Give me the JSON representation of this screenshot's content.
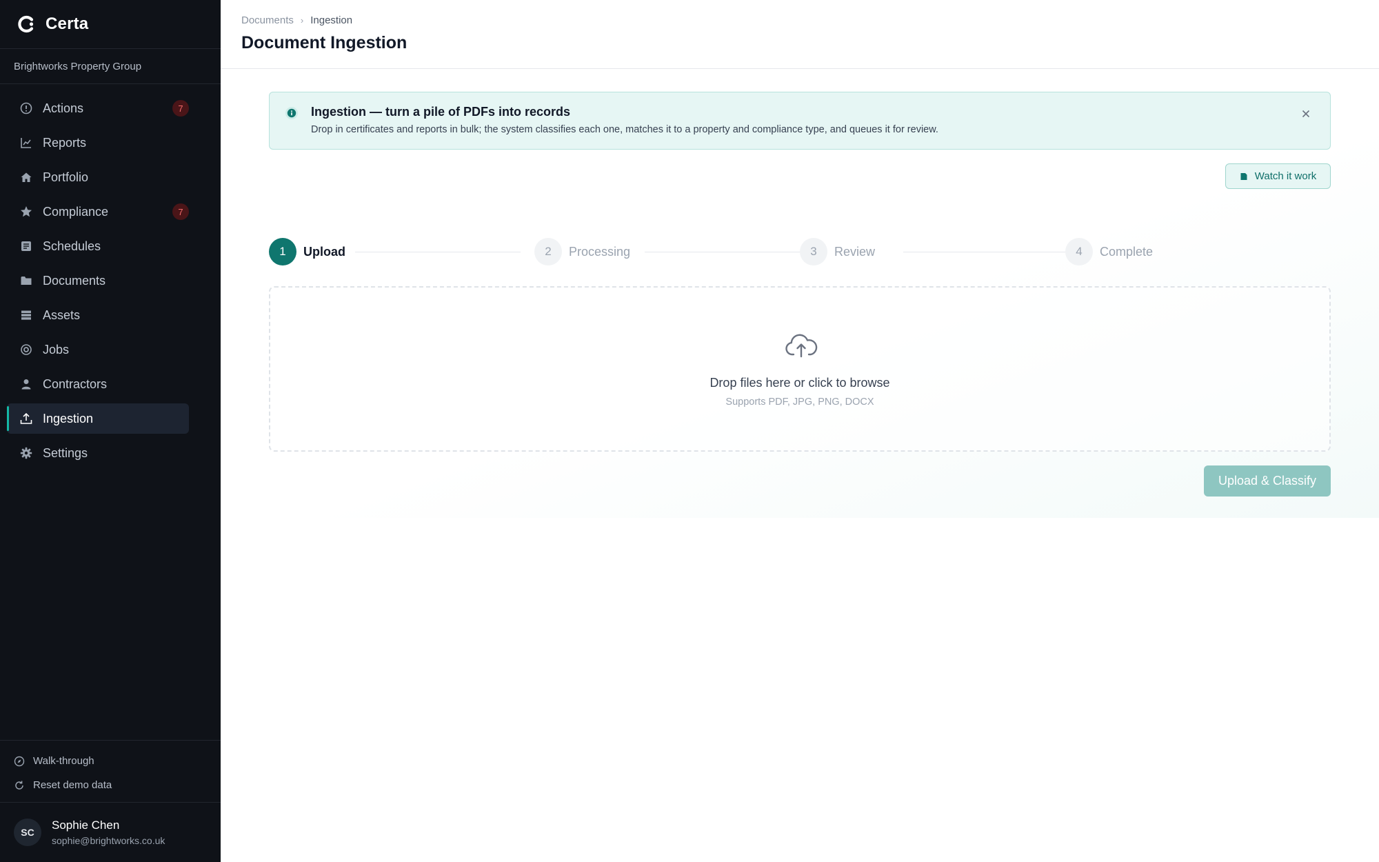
{
  "app": {
    "name": "Certa",
    "org": "Brightworks Property Group"
  },
  "sidebar": {
    "items": [
      {
        "label": "Actions",
        "badge": "7"
      },
      {
        "label": "Reports"
      },
      {
        "label": "Portfolio"
      },
      {
        "label": "Compliance",
        "badge": "7"
      },
      {
        "label": "Schedules"
      },
      {
        "label": "Documents"
      },
      {
        "label": "Assets"
      },
      {
        "label": "Jobs"
      },
      {
        "label": "Contractors"
      },
      {
        "label": "Ingestion",
        "active": true
      },
      {
        "label": "Settings"
      }
    ],
    "footer": {
      "walkthrough": "Walk-through",
      "reset": "Reset demo data"
    },
    "user": {
      "initials": "SC",
      "name": "Sophie Chen",
      "email": "sophie@brightworks.co.uk"
    }
  },
  "header": {
    "breadcrumb": [
      "Documents",
      "Ingestion"
    ],
    "title": "Document Ingestion"
  },
  "banner": {
    "title": "Ingestion — turn a pile of PDFs into records",
    "text": "Drop in certificates and reports in bulk; the system classifies each one, matches it to a property and compliance type, and queues it for review."
  },
  "watch_button": "Watch it work",
  "steps": [
    {
      "number": "1",
      "label": "Upload",
      "active": true
    },
    {
      "number": "2",
      "label": "Processing"
    },
    {
      "number": "3",
      "label": "Review"
    },
    {
      "number": "4",
      "label": "Complete"
    }
  ],
  "dropzone": {
    "text": "Drop files here or click to browse",
    "subtext": "Supports PDF, JPG, PNG, DOCX"
  },
  "upload_button": "Upload & Classify",
  "colors": {
    "accent": "#0f766e",
    "sidebar_bg": "#0f1218",
    "badge_text": "#f26b6b",
    "banner_bg": "#e6f6f4"
  }
}
